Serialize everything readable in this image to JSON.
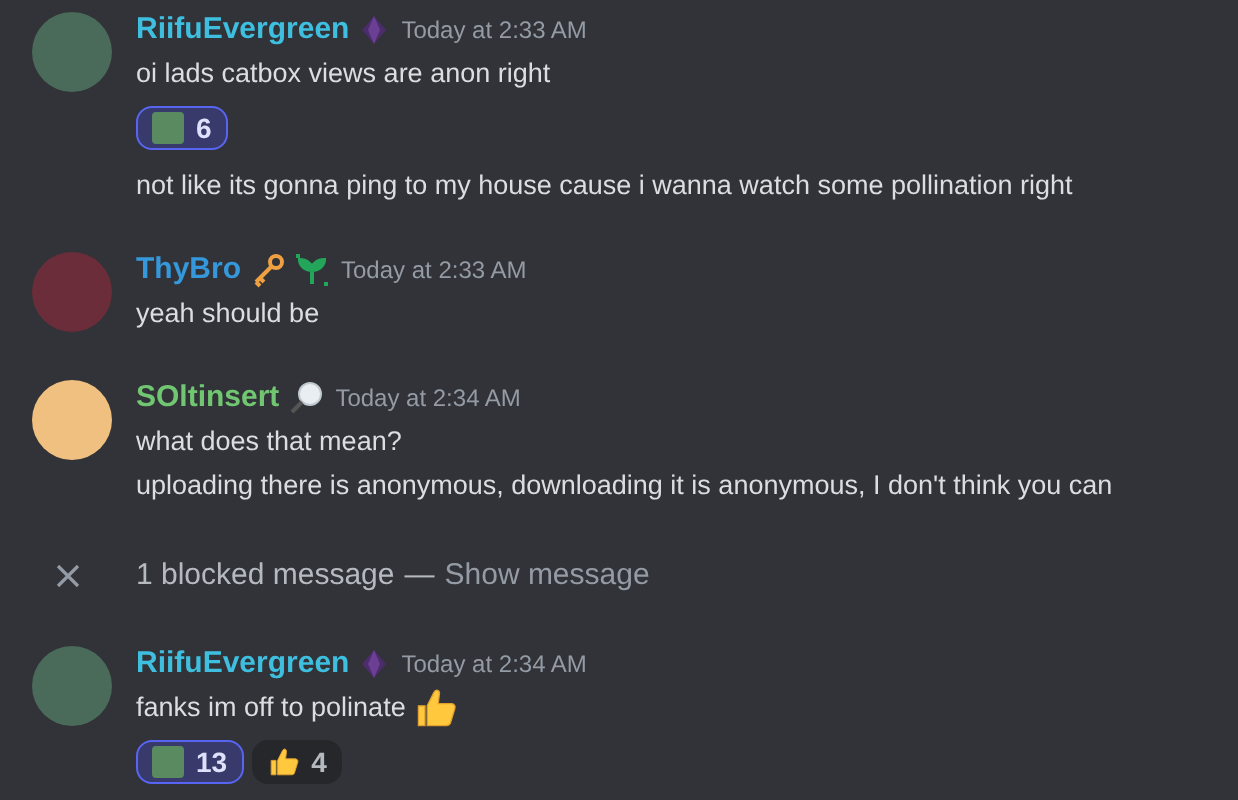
{
  "messages": [
    {
      "kind": "group",
      "author": "RiifuEvergreen",
      "color": "#3fbfdf",
      "timestamp": "Today at 2:33 AM",
      "lines": [
        {
          "text": "oi lads catbox views are anon right",
          "reactions": [
            {
              "kind": "custom",
              "count": "6",
              "selected": true
            }
          ]
        },
        {
          "text": "not like its gonna ping to my house cause i wanna watch some pollination right"
        }
      ]
    },
    {
      "kind": "group",
      "author": "ThyBro",
      "color": "#3498db",
      "timestamp": "Today at 2:33 AM",
      "lines": [
        {
          "text": "yeah should be"
        }
      ]
    },
    {
      "kind": "group",
      "author": "SOltinsert",
      "color": "#71c671",
      "timestamp": "Today at 2:34 AM",
      "lines": [
        {
          "text": "what does that mean?"
        },
        {
          "text": "uploading there is anonymous, downloading it is anonymous, I don't think you can"
        }
      ]
    },
    {
      "kind": "blocked",
      "label": "1 blocked message",
      "separator": "—",
      "link": "Show message"
    },
    {
      "kind": "group",
      "author": "RiifuEvergreen",
      "color": "#3fbfdf",
      "timestamp": "Today at 2:34 AM",
      "lines": [
        {
          "text": "fanks im off to polinate",
          "trailing_emoji": true,
          "reactions": [
            {
              "kind": "custom",
              "count": "13",
              "selected": true
            },
            {
              "kind": "thumb",
              "count": "4",
              "selected": false
            }
          ]
        }
      ]
    }
  ]
}
